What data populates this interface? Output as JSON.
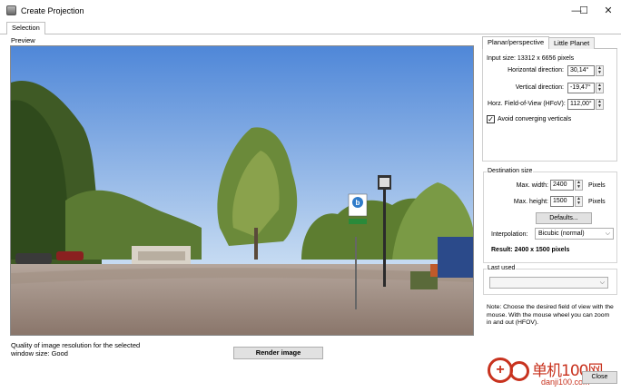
{
  "window": {
    "title": "Create Projection",
    "controls": {
      "minimize": "—",
      "maximize": "☐",
      "close": "✕"
    }
  },
  "main_tabs": [
    {
      "label": "Selection",
      "active": true
    }
  ],
  "preview": {
    "label": "Preview",
    "sign_letter": "b",
    "quality_text": "Quality of image resolution for the selected window size: Good"
  },
  "render_button": "Render image",
  "right_tabs": [
    {
      "label": "Planar/perspective",
      "active": true
    },
    {
      "label": "Little Planet",
      "active": false
    }
  ],
  "planar": {
    "input_size": "Input size: 13312 x 6656 pixels",
    "horizontal_label": "Horizontal direction:",
    "horizontal_value": "30,14°",
    "vertical_label": "Vertical direction:",
    "vertical_value": "-19,47°",
    "hfov_label": "Horz. Field-of-View (HFoV):",
    "hfov_value": "112,00°",
    "avoid_label": "Avoid converging verticals",
    "avoid_checked": true,
    "check_mark": "✓"
  },
  "destination": {
    "title": "Destination size",
    "max_width_label": "Max. width:",
    "max_width_value": "2400",
    "max_height_label": "Max. height:",
    "max_height_value": "1500",
    "unit": "Pixels",
    "defaults_button": "Defaults...",
    "interpolation_label": "Interpolation:",
    "interpolation_value": "Bicubic (normal)",
    "result": "Result: 2400 x 1500 pixels"
  },
  "last_used": {
    "title": "Last used",
    "value": ""
  },
  "note": "Note: Choose the desired field of view with the mouse. With the mouse wheel you can zoom in and out (HFOV).",
  "close_button": "Close",
  "watermark": {
    "cn": "单机100网",
    "url": "danji100.com"
  },
  "icons": {
    "arrow_up": "▲",
    "arrow_down": "▼",
    "dropdown": "⌵"
  },
  "colors": {
    "sky_top": "#4f87d8",
    "sky_bottom": "#c6dbf2",
    "pavement": "#9c8a80",
    "foliage": "#56702d",
    "watermark": "#c8321e"
  }
}
